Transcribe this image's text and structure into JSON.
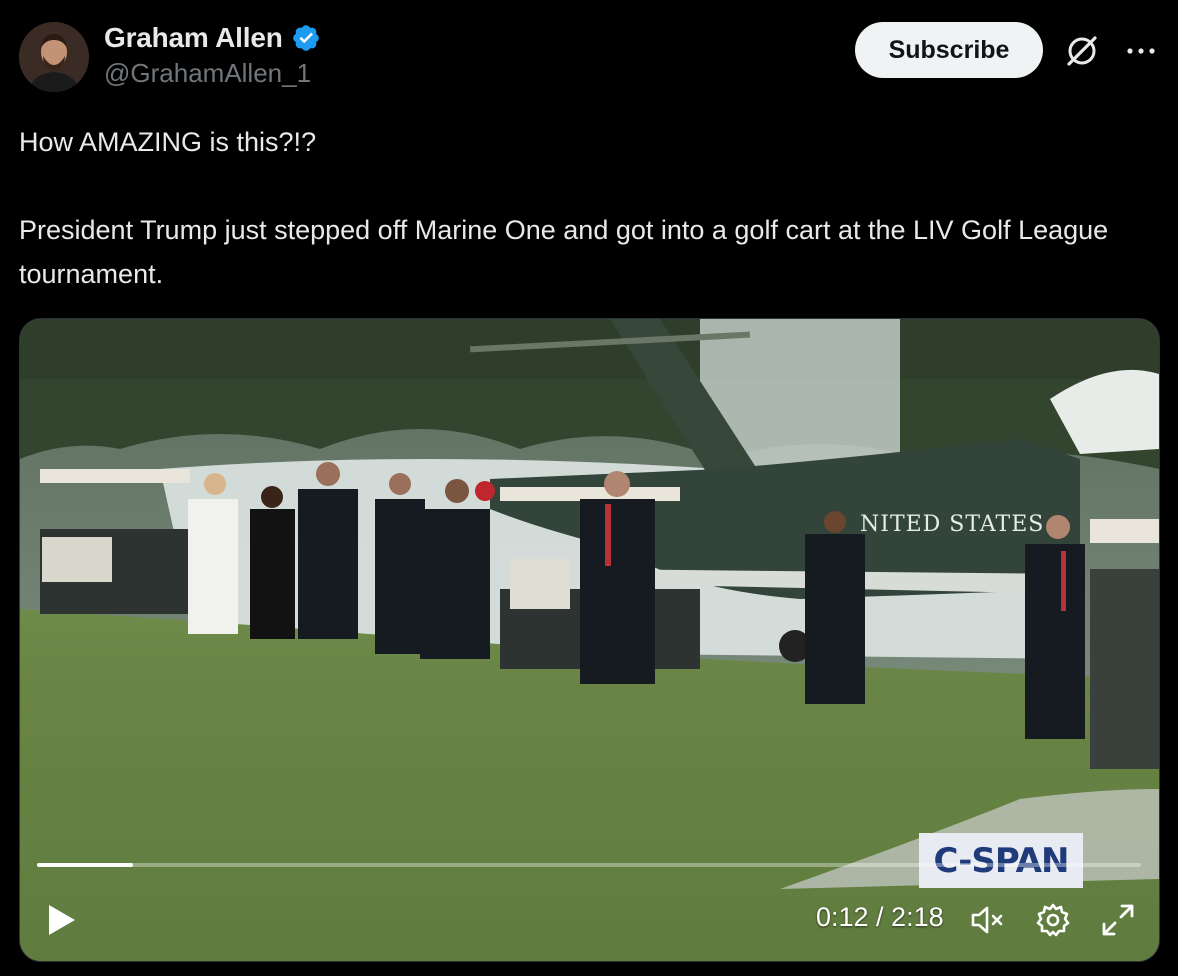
{
  "author": {
    "name": "Graham Allen",
    "handle": "@GrahamAllen_1",
    "verified": true
  },
  "header": {
    "subscribe_label": "Subscribe",
    "icons": [
      "grok-icon",
      "more-icon"
    ]
  },
  "tweet": {
    "text": "How AMAZING is this?!?\n\nPresident Trump just stepped off Marine One and got into a golf cart at the LIV Golf League tournament."
  },
  "video": {
    "watermark": "C-SPAN",
    "helicopter_text": "NITED STATES",
    "time_current": "0:12",
    "time_total": "2:18",
    "time_display": "0:12 / 2:18",
    "progress_fraction": 0.087,
    "controls": [
      "play-icon",
      "mute-icon",
      "settings-icon",
      "fullscreen-icon"
    ]
  },
  "colors": {
    "background": "#000000",
    "text": "#e7e9ea",
    "muted": "#71767b",
    "verified": "#1d9bf0",
    "subscribe_bg": "#eff3f4"
  }
}
